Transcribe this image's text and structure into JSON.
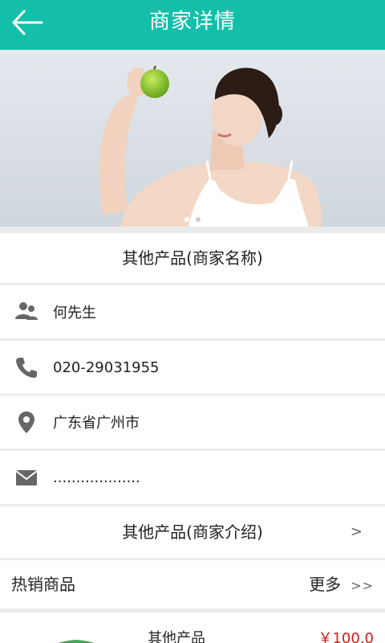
{
  "header": {
    "title": "商家详情",
    "accent_color": "#14bfaa"
  },
  "banner": {
    "image": "woman-holding-green-apple",
    "dots": 2,
    "active_dot": 1
  },
  "merchant": {
    "name": "其他产品(商家名称)",
    "contact_person": "何先生",
    "phone": "020-29031955",
    "address": "广东省广州市",
    "email": "..................."
  },
  "intro": {
    "label": "其他产品(商家介绍)",
    "arrow": ">"
  },
  "hot_products": {
    "title": "热销商品",
    "more_label": "更多",
    "more_arrow": ">>"
  },
  "products": [
    {
      "name": "其他产品",
      "price": "￥100.0"
    }
  ],
  "icons": {
    "contact": "user-group-icon",
    "phone": "phone-icon",
    "address": "location-pin-icon",
    "email": "envelope-icon"
  }
}
